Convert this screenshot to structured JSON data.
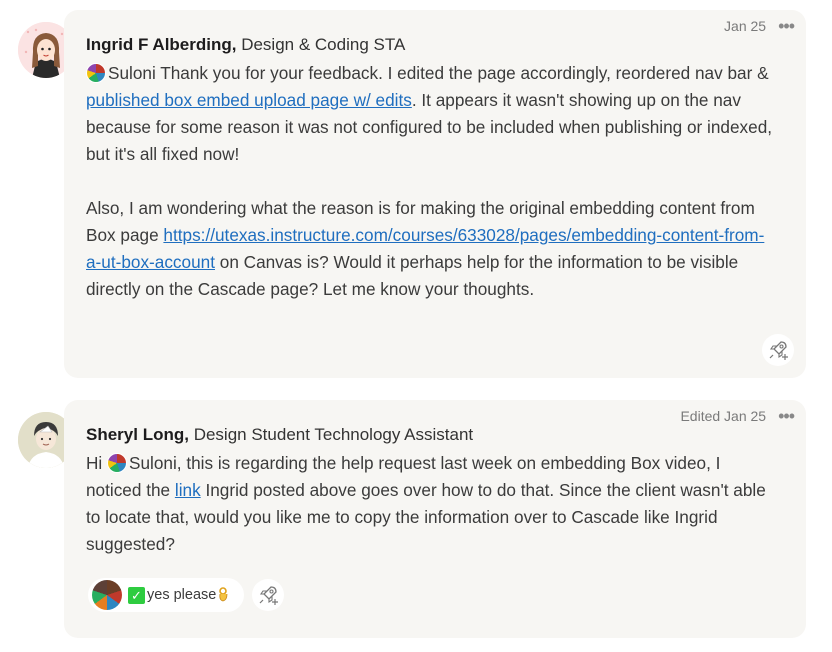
{
  "messages": [
    {
      "author": "Ingrid F Alberding,",
      "role": "Design & Coding STA",
      "timestamp": "Jan 25",
      "avatar_icon": "profile-avatar",
      "body": {
        "p1_mention": "Suloni",
        "p1_text_a": " Thank you for your feedback. I edited the page accordingly, reordered nav bar & ",
        "p1_link": "published box embed upload page w/ edits",
        "p1_text_b": ". It appears it wasn't showing up on the nav because for some reason it was not configured to be included when publishing or indexed, but it's all fixed now!",
        "p2_text_a": "Also, I am wondering what the reason is for making the original embedding content from Box page ",
        "p2_link": "https://utexas.instructure.com/courses/633028/pages/embedding-content-from-a-ut-box-account",
        "p2_text_b": " on Canvas is? Would it perhaps help for the information to be visible directly on the Cascade page? Let me know your thoughts."
      },
      "react_icon": "rocket-add-reaction-icon"
    },
    {
      "author": "Sheryl Long,",
      "role": "Design Student Technology Assistant",
      "timestamp": "Edited Jan 25",
      "avatar_icon": "profile-avatar",
      "body": {
        "text_a": "Hi ",
        "mention": "Suloni",
        "text_b": ", this is regarding the help request last week on embedding Box video, I noticed the ",
        "link": "link",
        "text_c": " Ingrid posted above goes over how to do that. Since the client wasn't able to locate that, would you like me to copy the information over to Cascade like Ingrid suggested?"
      },
      "reaction": {
        "check": "✓",
        "text": "yes please",
        "hand_icon": "ok-hand-icon"
      },
      "react_icon": "rocket-add-reaction-icon"
    }
  ],
  "colors": {
    "card_bg": "#f7f6f3",
    "link": "#1f6ebf",
    "timestamp": "#7a7a7a",
    "check_green": "#2ecc40"
  }
}
